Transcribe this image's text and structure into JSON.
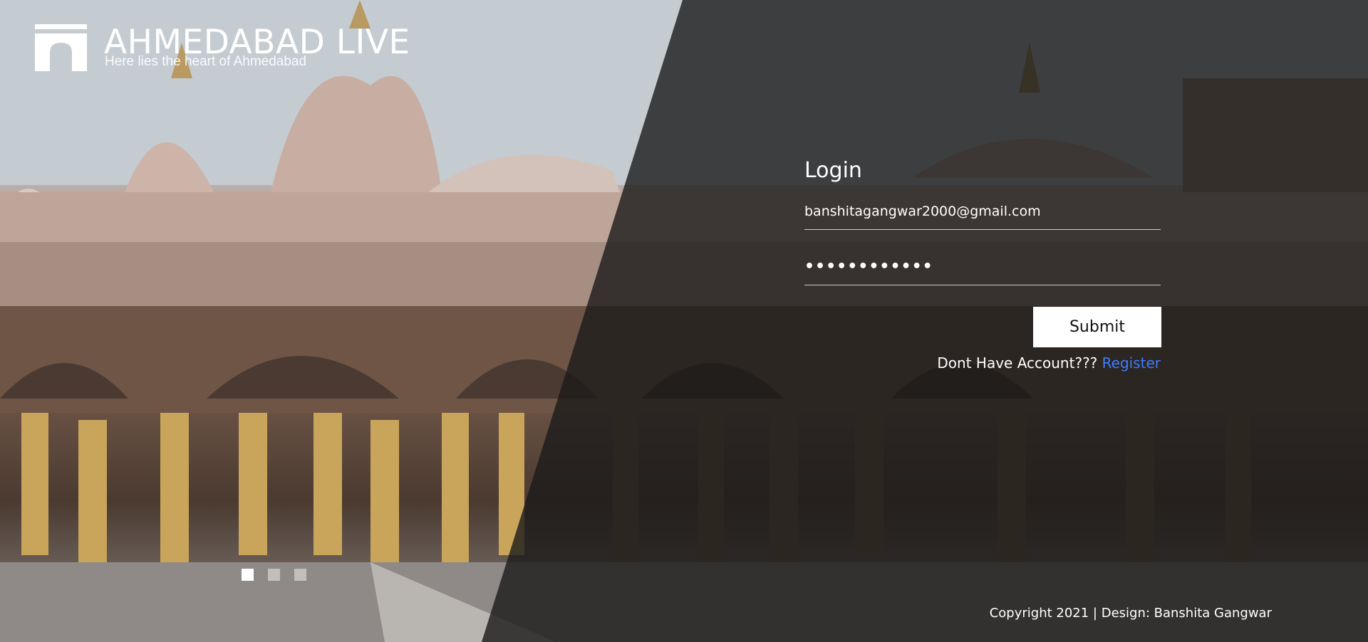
{
  "brand": {
    "title": "AHMEDABAD LIVE",
    "subtitle": "Here lies the heart of Ahmedabad",
    "logo_icon": "arch-gate-icon"
  },
  "slider": {
    "dots": [
      {
        "label": "slide-1",
        "active": true
      },
      {
        "label": "slide-2",
        "active": false
      },
      {
        "label": "slide-3",
        "active": false
      }
    ]
  },
  "login": {
    "title": "Login",
    "email_value": "banshitagangwar2000@gmail.com",
    "password_value": "••••••••••••",
    "submit_label": "Submit",
    "no_account_text": "Dont Have Account???",
    "register_label": "Register"
  },
  "footer": {
    "copyright": "Copyright 2021 | Design: Banshita Gangwar"
  },
  "colors": {
    "overlay": "#1c1a1a",
    "link": "#3f7bff",
    "button_bg": "#ffffff",
    "button_text": "#111111"
  }
}
